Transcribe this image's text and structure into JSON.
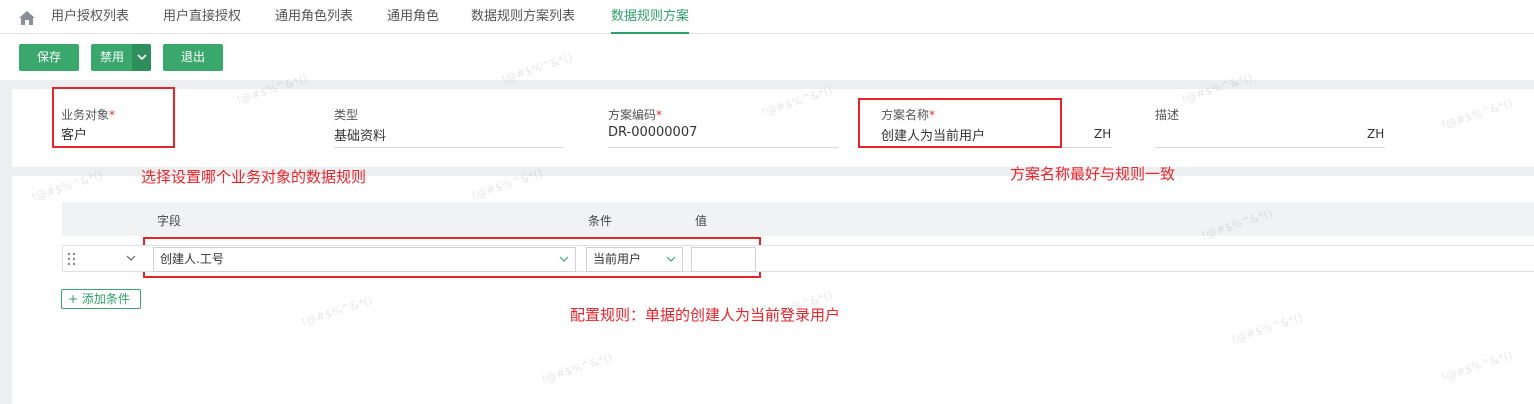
{
  "tabs": [
    {
      "label": "用户授权列表",
      "active": false
    },
    {
      "label": "用户直接授权",
      "active": false
    },
    {
      "label": "通用角色列表",
      "active": false
    },
    {
      "label": "通用角色",
      "active": false
    },
    {
      "label": "数据规则方案列表",
      "active": false
    },
    {
      "label": "数据规则方案",
      "active": true
    }
  ],
  "toolbar": {
    "save_label": "保存",
    "disable_label": "禁用",
    "exit_label": "退出"
  },
  "form": {
    "business_object": {
      "label": "业务对象",
      "value": "客户"
    },
    "type": {
      "label": "类型",
      "value": "基础资料"
    },
    "code": {
      "label": "方案编码",
      "value": "DR-00000007"
    },
    "name": {
      "label": "方案名称",
      "value": "创建人为当前用户",
      "lang": "ZH"
    },
    "desc": {
      "label": "描述",
      "value": "",
      "lang": "ZH"
    },
    "required_mark": "*"
  },
  "grid": {
    "headers": {
      "field": "字段",
      "condition": "条件",
      "value": "值"
    },
    "row": {
      "field": "创建人.工号",
      "condition": "当前用户",
      "value": ""
    },
    "add_label": "添加条件"
  },
  "annotations": {
    "note1": "选择设置哪个业务对象的数据规则",
    "note2": "方案名称最好与规则一致",
    "note3": "配置规则：单据的创建人为当前登录用户"
  },
  "watermark": "!@#$%^&*()",
  "colors": {
    "accent": "#3aa86d",
    "annotation": "#e8242b"
  }
}
